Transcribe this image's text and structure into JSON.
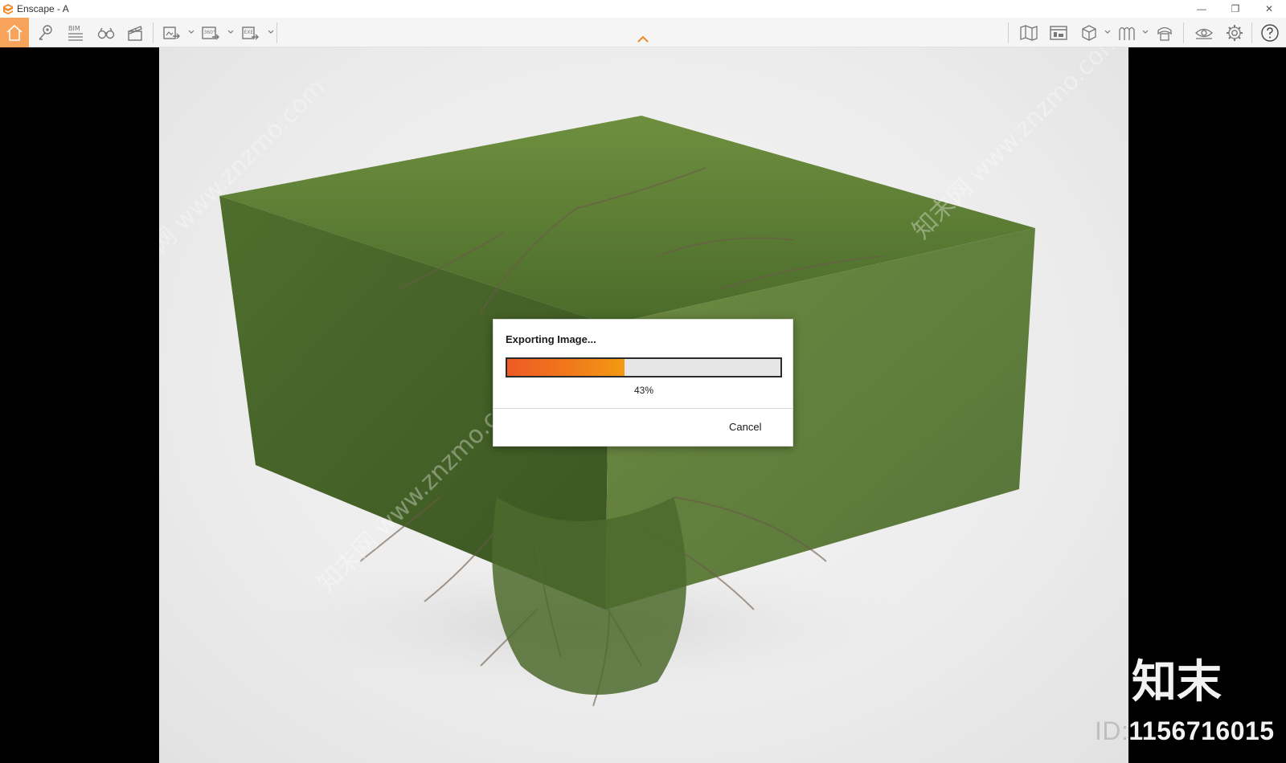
{
  "window": {
    "title": "Enscape - A",
    "controls": {
      "minimize": "—",
      "restore": "❐",
      "close": "✕"
    }
  },
  "toolbar": {
    "left_icons": [
      "home-icon",
      "views-icon",
      "bim-icon",
      "binoculars-icon",
      "clapperboard-icon",
      "screenshot-export-icon",
      "panorama-360-export-icon",
      "exe-export-icon"
    ],
    "bim_label": "BIM",
    "pano_label": "360°",
    "exe_label": "EXE",
    "right_icons": [
      "map-icon",
      "asset-library-icon",
      "visual-presets-icon",
      "material-editor-icon",
      "uploads-icon",
      "eye-visibility-icon",
      "settings-icon",
      "help-icon"
    ],
    "active_color": "#f7a35c",
    "accent_color": "#f08a24"
  },
  "dialog": {
    "title": "Exporting Image...",
    "progress_percent": 43,
    "progress_text": "43%",
    "cancel_label": "Cancel",
    "bar_colors": [
      "#ee5a24",
      "#f39a12"
    ]
  },
  "watermark": {
    "logo_text": "知末",
    "id_label": "ID:",
    "id_value": "1156716015",
    "diagonal_text": "知末网 www.znzmo.com"
  }
}
